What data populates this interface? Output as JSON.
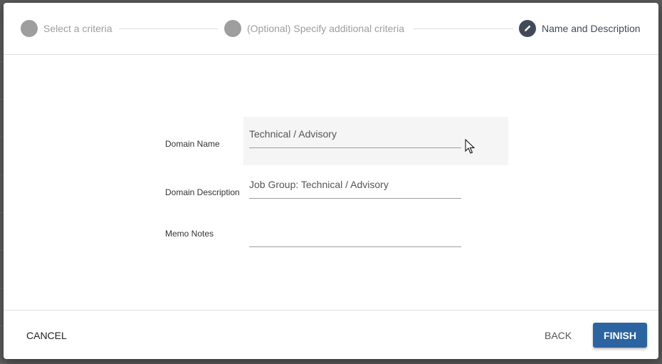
{
  "stepper": {
    "steps": [
      {
        "label": "Select a criteria",
        "state": "inactive"
      },
      {
        "label": "(Optional) Specify additional criteria",
        "state": "inactive"
      },
      {
        "label": "Name and Description",
        "state": "active",
        "icon": "pencil-icon"
      }
    ]
  },
  "form": {
    "domain_name": {
      "label": "Domain Name",
      "value": "Technical / Advisory"
    },
    "domain_description": {
      "label": "Domain Description",
      "value": "Job Group: Technical / Advisory"
    },
    "memo_notes": {
      "label": "Memo Notes",
      "value": ""
    }
  },
  "footer": {
    "cancel_label": "CANCEL",
    "back_label": "BACK",
    "finish_label": "FINISH"
  },
  "colors": {
    "primary": "#2b64a0",
    "active_step": "#414a59",
    "inactive_step": "#9e9e9e"
  }
}
